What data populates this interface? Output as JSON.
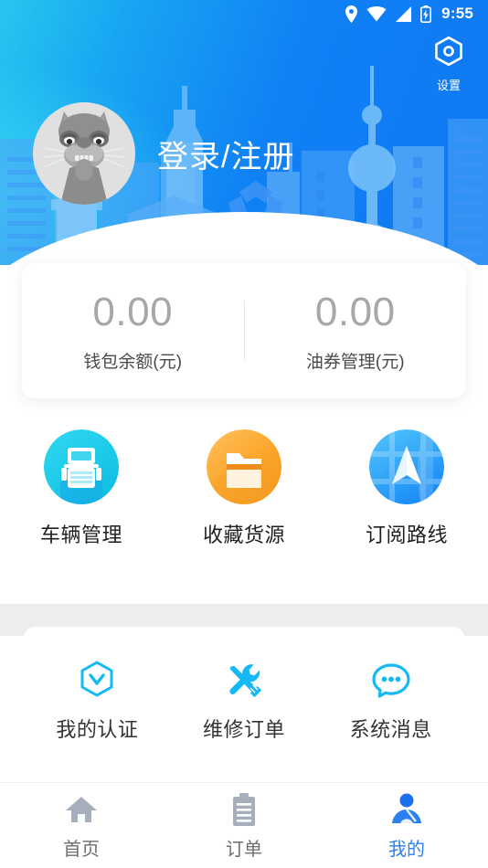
{
  "statusbar": {
    "time": "9:55",
    "icons": [
      "location-pin-icon",
      "wifi-icon",
      "cellular-signal-icon",
      "battery-charging-icon"
    ]
  },
  "header": {
    "settings_label": "设置",
    "settings_icon": "hexagon-gear-icon",
    "login_text": "登录/注册",
    "avatar_icon": "user-avatar-animal",
    "gradient_start": "#29C6EF",
    "gradient_end": "#0F78F2"
  },
  "wallet": {
    "columns": [
      {
        "value": "0.00",
        "label": "钱包余额(元)"
      },
      {
        "value": "0.00",
        "label": "油券管理(元)"
      }
    ],
    "value_color": "#A7A7A7",
    "label_color": "#4A4A4A"
  },
  "shortcuts": [
    {
      "label": "车辆管理",
      "icon": "truck-icon",
      "color": "#22C9E8"
    },
    {
      "label": "收藏货源",
      "icon": "folder-icon",
      "color": "#FBA72C"
    },
    {
      "label": "订阅路线",
      "icon": "navigation-arrow-icon",
      "color": "#2BA6F8"
    }
  ],
  "services": [
    {
      "label": "我的认证",
      "icon": "hexagon-check-icon",
      "color": "#14B9F5"
    },
    {
      "label": "维修订单",
      "icon": "wrench-screwdriver-icon",
      "color": "#14B9F5"
    },
    {
      "label": "系统消息",
      "icon": "chat-bubble-dots-icon",
      "color": "#14B9F5"
    }
  ],
  "tabbar": {
    "active_color": "#2B7FEE",
    "inactive_color": "#A7AFBD",
    "items": [
      {
        "label": "首页",
        "icon": "home-icon",
        "active": false
      },
      {
        "label": "订单",
        "icon": "clipboard-icon",
        "active": false
      },
      {
        "label": "我的",
        "icon": "person-icon",
        "active": true
      }
    ]
  }
}
